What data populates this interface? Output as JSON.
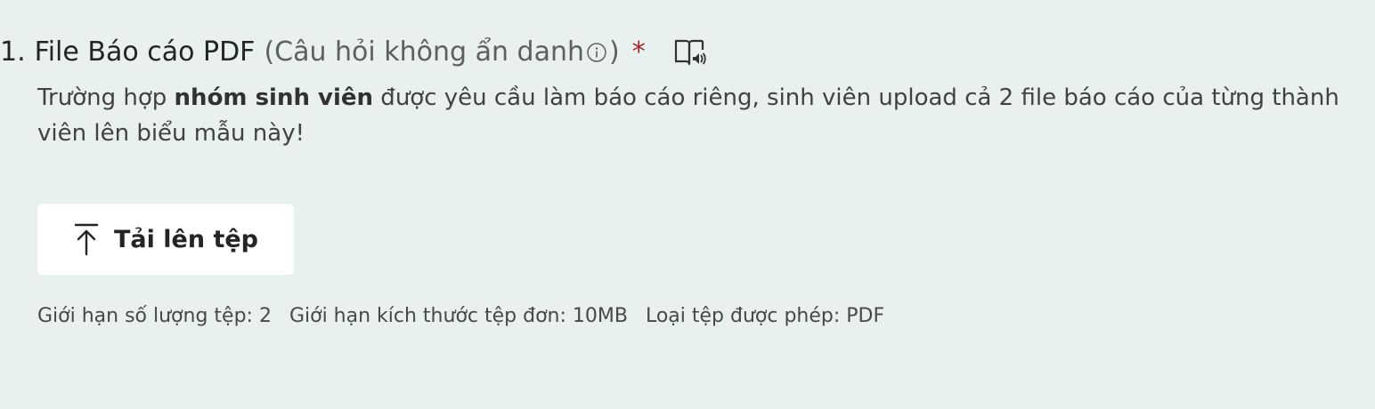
{
  "question": {
    "number": "1.",
    "title": "File Báo cáo PDF",
    "subtitle": "(Câu hỏi không ẩn danh",
    "subtitle_close": ")",
    "required_mark": "*",
    "description_prefix": "Trường hợp ",
    "description_bold": "nhóm sinh viên",
    "description_suffix": " được yêu cầu làm báo cáo riêng, sinh viên upload cả 2 file báo cáo của từng thành viên lên biểu mẫu này!"
  },
  "upload": {
    "button_label": "Tải lên tệp",
    "icon": "upload-icon"
  },
  "limits": {
    "file_count": "Giới hạn số lượng tệp: 2",
    "file_size": "Giới hạn kích thước tệp đơn: 10MB",
    "file_types": "Loại tệp được phép: PDF"
  },
  "icons": {
    "info": "info-icon",
    "immersive_reader": "immersive-reader-icon"
  },
  "colors": {
    "background": "#e8f0f0",
    "required": "#a4262c",
    "button_bg": "#ffffff"
  }
}
